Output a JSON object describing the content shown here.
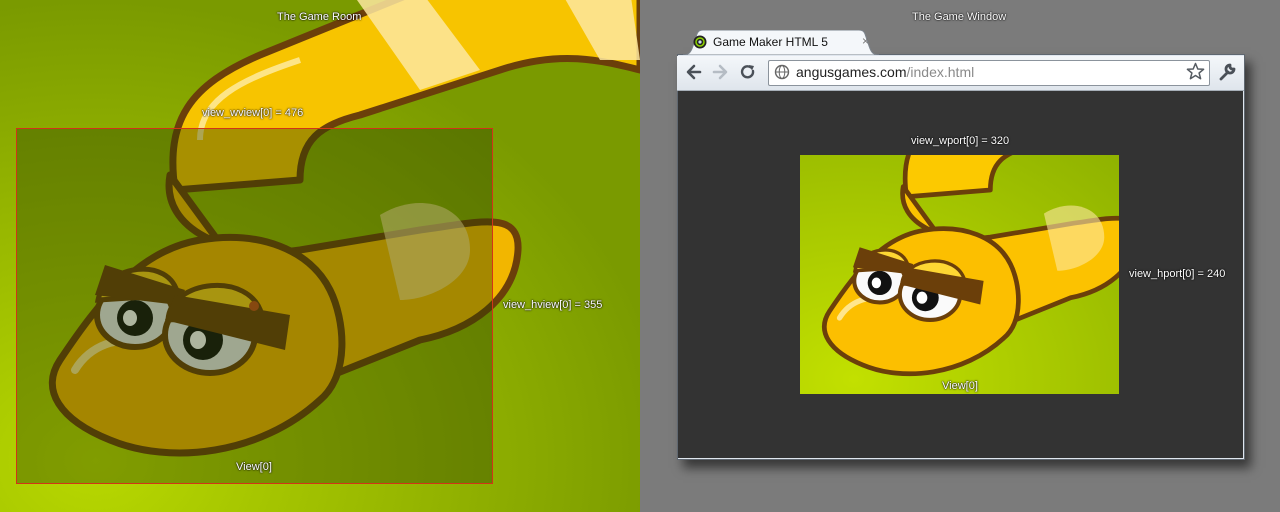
{
  "room": {
    "title": "The Game Room",
    "view_wview": "view_wview[0] = 476",
    "view_hview": "view_hview[0] = 355",
    "view_label": "View[0]"
  },
  "window": {
    "title": "The Game Window",
    "tab_title": "Game Maker HTML 5",
    "tab_close": "×",
    "url_host": "angusgames.com",
    "url_path": "/index.html",
    "view_wport": "view_wport[0] = 320",
    "view_hport": "view_hport[0] = 240",
    "view_label": "View[0]"
  },
  "colors": {
    "room_bg": "#9fc100",
    "snake_yellow": "#f5b800",
    "outline": "#6b3f0a",
    "view_border": "#cc2a1a",
    "viewport_bg": "#333333"
  },
  "icons": [
    "back-arrow-icon",
    "forward-arrow-icon",
    "reload-icon",
    "globe-icon",
    "star-icon",
    "wrench-icon"
  ]
}
